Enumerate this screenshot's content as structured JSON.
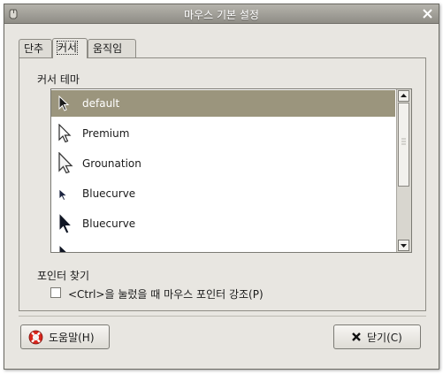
{
  "window": {
    "title": "마우스 기본 설정"
  },
  "tabs": [
    {
      "label": "단추"
    },
    {
      "label": "커서"
    },
    {
      "label": "움직임"
    }
  ],
  "cursor_theme": {
    "label": "커서 테마",
    "items": [
      {
        "label": "default",
        "selected": true
      },
      {
        "label": "Premium"
      },
      {
        "label": "Grounation"
      },
      {
        "label": "Bluecurve"
      },
      {
        "label": "Bluecurve"
      }
    ]
  },
  "pointer_find": {
    "label": "포인터 찾기",
    "checkbox_label": "<Ctrl>을 눌렀을 때 마우스 포인터 강조(P)",
    "checked": false
  },
  "buttons": {
    "help": "도움말(H)",
    "close": "닫기(C)"
  },
  "colors": {
    "selection": "#9b957d",
    "titlebar": "#a3a19a",
    "window_bg": "#e8e6e1"
  }
}
